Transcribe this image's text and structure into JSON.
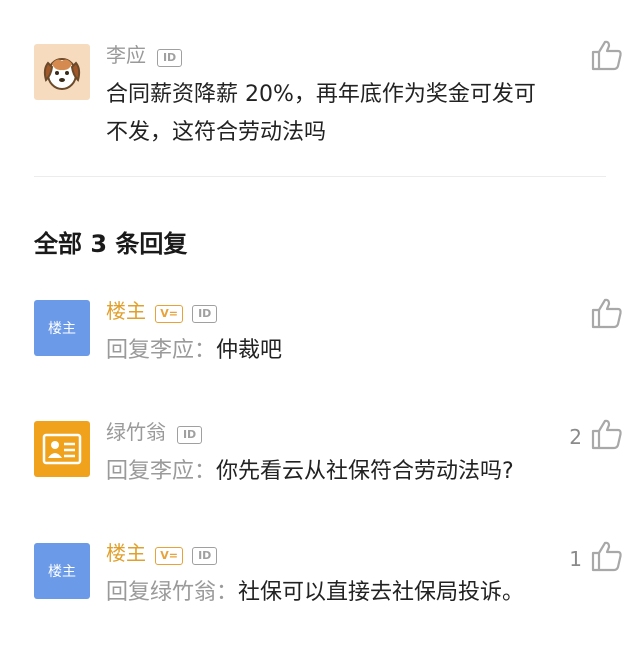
{
  "main_comment": {
    "author": "李应",
    "id_badge": "ID",
    "text_line1": "合同薪资降薪 20%，再年底作为奖金可发可",
    "text_line2": "不发，这符合劳动法吗"
  },
  "replies_header": "全部 3 条回复",
  "replies": [
    {
      "avatar_text": "楼主",
      "author": "楼主",
      "v_badge": "V=",
      "id_badge": "ID",
      "reply_prefix": "回复李应：",
      "text": "仲裁吧",
      "likes": ""
    },
    {
      "avatar_text": "",
      "author": "绿竹翁",
      "v_badge": "",
      "id_badge": "ID",
      "reply_prefix": "回复李应：",
      "text": "你先看云从社保符合劳动法吗?",
      "likes": "2"
    },
    {
      "avatar_text": "楼主",
      "author": "楼主",
      "v_badge": "V=",
      "id_badge": "ID",
      "reply_prefix": "回复绿竹翁：",
      "text": "社保可以直接去社保局投诉。",
      "likes": "1"
    }
  ],
  "colors": {
    "op_name": "#e0a02d",
    "op_avatar": "#6b9ae8",
    "reply2_avatar": "#f0a21c",
    "dog_avatar_bg": "#f6dbbf"
  },
  "icons": {
    "like": "thumbs-up-icon",
    "dog": "dog-avatar-icon",
    "id_card": "id-card-icon"
  }
}
